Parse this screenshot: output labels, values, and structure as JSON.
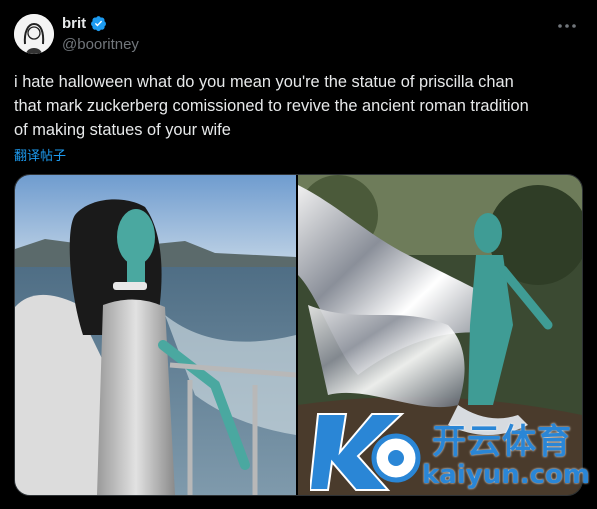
{
  "author": {
    "display_name": "brit",
    "handle": "@booritney",
    "avatar": "sketch-portrait-avatar",
    "verified_icon": "verified-badge-icon",
    "verified_color": "#1d9bf0"
  },
  "tweet": {
    "text": "i hate halloween what do you mean you're the statue of priscilla chan\nthat mark zuckerberg comissioned to revive the ancient roman tradition\nof making statues of your wife",
    "translate_label": "翻译帖子"
  },
  "media": {
    "photos": [
      {
        "subject": "woman-in-silver-dress-on-boat"
      },
      {
        "subject": "chrome-statue-in-garden"
      }
    ]
  },
  "watermark": {
    "cn": "开云体育",
    "en": "kaiyun.com"
  },
  "colors": {
    "background": "#000000",
    "text": "#e7e9ea",
    "secondary": "#71767b",
    "link": "#1d9bf0"
  }
}
